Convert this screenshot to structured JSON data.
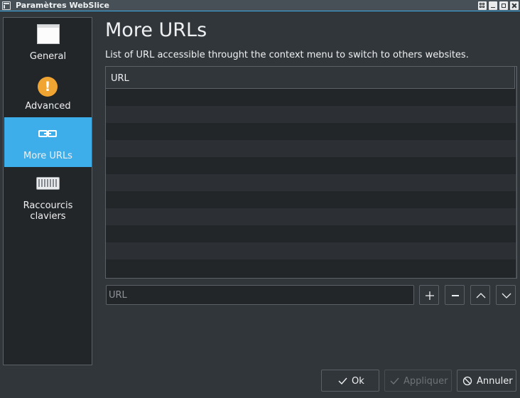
{
  "window": {
    "title": "Paramètres WebSlice"
  },
  "sidebar": {
    "items": [
      {
        "label": "General",
        "icon": "window-icon",
        "active": false
      },
      {
        "label": "Advanced",
        "icon": "warning-icon",
        "icon_glyph": "!",
        "active": false
      },
      {
        "label": "More URLs",
        "icon": "link-icon",
        "active": true
      },
      {
        "label": "Raccourcis claviers",
        "icon": "keyboard-icon",
        "active": false
      }
    ]
  },
  "main": {
    "title": "More URLs",
    "description": "List of URL accessible throught the context menu to switch to others websites.",
    "table": {
      "columns": [
        "URL"
      ],
      "rows": []
    },
    "url_input": {
      "placeholder": "URL",
      "value": ""
    },
    "list_buttons": [
      {
        "name": "add",
        "icon": "plus-icon"
      },
      {
        "name": "remove",
        "icon": "minus-icon"
      },
      {
        "name": "move-up",
        "icon": "chevron-up-icon"
      },
      {
        "name": "move-down",
        "icon": "chevron-down-icon"
      }
    ]
  },
  "footer": {
    "ok_label": "Ok",
    "apply_label": "Appliquer",
    "cancel_label": "Annuler",
    "apply_enabled": false
  },
  "colors": {
    "accent": "#3daee9",
    "background": "#31363b",
    "view_background": "#232629",
    "text": "#eff0f1",
    "warning": "#f0a431"
  }
}
